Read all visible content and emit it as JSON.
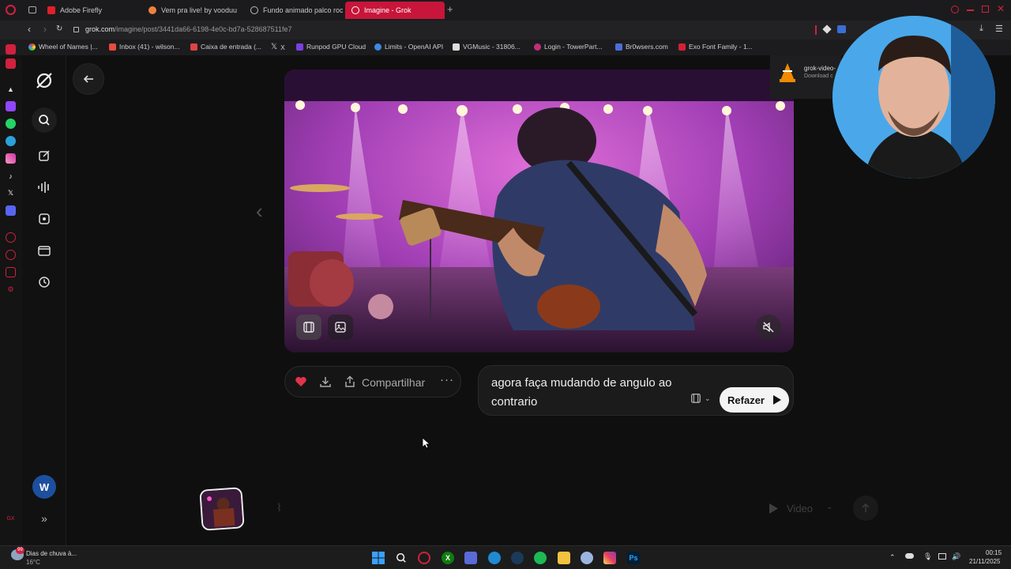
{
  "browser": {
    "tabs": [
      {
        "label": "Adobe Firefly",
        "active": false
      },
      {
        "label": "Vem pra live! by vooduu",
        "active": false
      },
      {
        "label": "Fundo animado palco roc",
        "active": false
      },
      {
        "label": "Imagine - Grok",
        "active": true
      }
    ],
    "url_host": "grok.com",
    "url_path": "/imagine/post/3441da66-6198-4e0c-bd7a-528687511fe7",
    "bookmarks": [
      "Wheel of Names |...",
      "Inbox (41) - wilson...",
      "Caixa de entrada (...",
      "X",
      "Runpod GPU Cloud",
      "Limits - OpenAI API",
      "VGMusic - 31806...",
      "Login - TowerPart...",
      "Br0wsers.com",
      "Exo Font Family - 1..."
    ]
  },
  "download": {
    "file": "grok-video-",
    "status": "Download c"
  },
  "actions": {
    "share_label": "Compartilhar"
  },
  "prompt": {
    "text": "agora faça mudando de angulo ao contrario",
    "submit_label": "Refazer"
  },
  "composer": {
    "mode_label": "Video"
  },
  "taskbar": {
    "weather_title": "Dias de chuva à...",
    "weather_temp": "16°C",
    "time": "00:15",
    "date": "21/11/2025",
    "notification_badge": "99"
  },
  "colors": {
    "accent": "#c8153a",
    "background": "#0f0f0f",
    "like": "#e0334c"
  }
}
